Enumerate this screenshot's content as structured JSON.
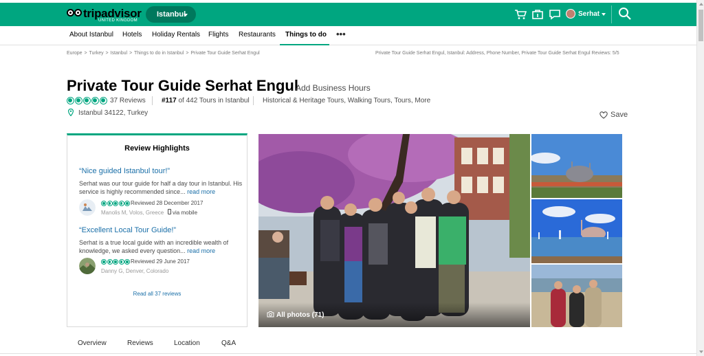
{
  "header": {
    "logo_text": "tripadvisor",
    "logo_sub": "UNITED KINGDOM",
    "city": "Istanbul",
    "user_name": "Serhat",
    "brand_color": "#00a680",
    "icons": [
      "cart-icon",
      "trips-icon",
      "messages-icon",
      "search-icon"
    ]
  },
  "subnav": {
    "items": [
      "About Istanbul",
      "Hotels",
      "Holiday Rentals",
      "Flights",
      "Restaurants",
      "Things to do"
    ],
    "active": "Things to do",
    "more": "•••"
  },
  "breadcrumb": {
    "items": [
      "Europe",
      "Turkey",
      "Istanbul",
      "Things to do in Istanbul",
      "Private Tour Guide Serhat Engul"
    ],
    "separator": ">",
    "right_text": "Private Tour Guide Serhat Engul, Istanbul: Address, Phone Number, Private Tour Guide Serhat Engul Reviews: 5/5"
  },
  "listing": {
    "title": "Private Tour Guide Serhat Engul",
    "add_hours": "Add Business Hours",
    "rating": 5,
    "reviews_count": "37 Reviews",
    "rank_number": "#117",
    "rank_text": "of 442 Tours in Istanbul",
    "categories": "Historical & Heritage Tours, Walking Tours, Tours, More",
    "address": "Istanbul 34122, Turkey",
    "save_label": "Save"
  },
  "highlights": {
    "title": "Review Highlights",
    "reviews": [
      {
        "title": "“Nice guided Istanbul tour!”",
        "body": "Serhat was our tour guide for half a day tour in Istanbul. His service is highly recommended since...",
        "more": "read more",
        "rating": 5,
        "date": "Reviewed 28 December 2017",
        "user": "Manolis M, Volos, Greece",
        "device": "via mobile"
      },
      {
        "title": "“Excellent Local Tour Guide!”",
        "body": "Serhat is a true local guide with an incredible wealth of knowledge, we asked every question...",
        "more": "read more",
        "rating": 5,
        "date": "Reviewed 29 June 2017",
        "user": "Danny G, Denver, Colorado",
        "device": ""
      }
    ],
    "read_all": "Read all 37 reviews"
  },
  "photos": {
    "all_label": "All photos (71)"
  },
  "tabs": [
    "Overview",
    "Reviews",
    "Location",
    "Q&A"
  ]
}
